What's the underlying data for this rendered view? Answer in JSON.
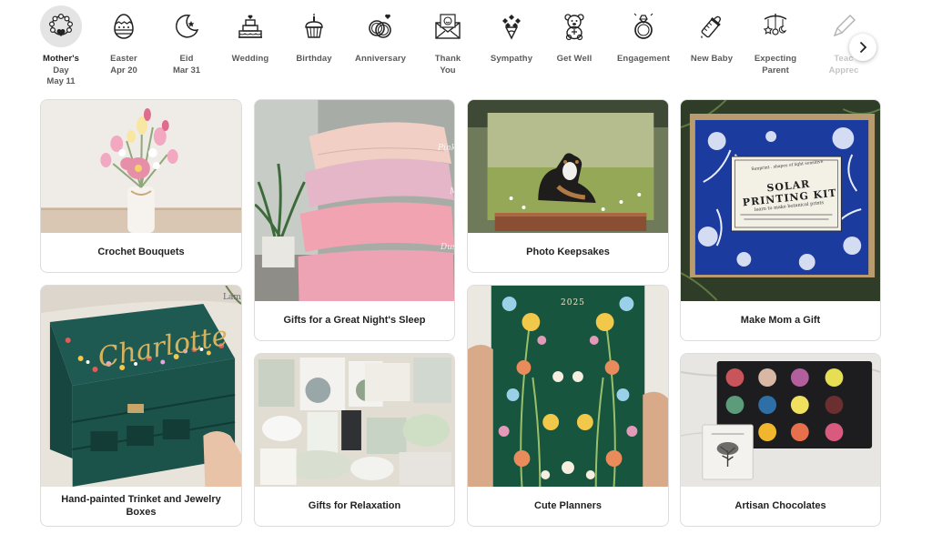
{
  "occasions": [
    {
      "label": "Mother's Day",
      "label_line1": "Mother's",
      "label_line2": "Day",
      "date": "May 11",
      "icon": "pearl-necklace-icon",
      "active": true
    },
    {
      "label": "Easter",
      "date": "Apr 20",
      "icon": "easter-egg-icon"
    },
    {
      "label": "Eid",
      "date": "Mar 31",
      "icon": "crescent-moon-icon"
    },
    {
      "label": "Wedding",
      "icon": "wedding-cake-icon"
    },
    {
      "label": "Birthday",
      "icon": "birthday-cupcake-icon"
    },
    {
      "label": "Anniversary",
      "icon": "rings-icon"
    },
    {
      "label": "Thank You",
      "label_line1": "Thank",
      "label_line2": "You",
      "icon": "envelope-heart-icon"
    },
    {
      "label": "Sympathy",
      "icon": "flower-bouquet-icon"
    },
    {
      "label": "Get Well",
      "icon": "teddy-bear-icon"
    },
    {
      "label": "Engagement",
      "icon": "engagement-ring-icon"
    },
    {
      "label": "New Baby",
      "icon": "baby-bottle-icon"
    },
    {
      "label": "Expecting Parent",
      "label_line1": "Expecting",
      "label_line2": "Parent",
      "icon": "baby-mobile-icon"
    },
    {
      "label": "Teacher Appreciation",
      "label_line1": "Teac",
      "label_line2": "Apprec",
      "icon": "pencil-icon"
    }
  ],
  "next_button": {
    "icon": "chevron-right-icon"
  },
  "cards": {
    "crochet": {
      "title": "Crochet Bouquets"
    },
    "sleep": {
      "title": "Gifts for a Great Night's Sleep",
      "photo_text": [
        "Pink",
        "M",
        "Dus"
      ]
    },
    "photo": {
      "title": "Photo Keepsakes"
    },
    "solar": {
      "title": "Make Mom a Gift",
      "kit_title_1": "SOLAR PRINTING KIT",
      "kit_small": "Sunprint . shapes of light sensitive",
      "kit_sub": "learn to make botanical prints"
    },
    "jewelry": {
      "title": "Hand-painted Trinket and Jewelry Boxes",
      "title_line1": "Hand-painted Trinket and Jewelry",
      "title_line2": "Boxes",
      "photo_text": "Lamo",
      "script": "Charlotte"
    },
    "relax": {
      "title": "Gifts for Relaxation"
    },
    "planner": {
      "title": "Cute Planners",
      "year": "2025"
    },
    "choc": {
      "title": "Artisan Chocolates"
    }
  },
  "colors": {
    "accent_text": "#222222",
    "muted_text": "#5a5a5a",
    "active_bg": "#e4e4e4",
    "border": "#dcdcdc"
  }
}
